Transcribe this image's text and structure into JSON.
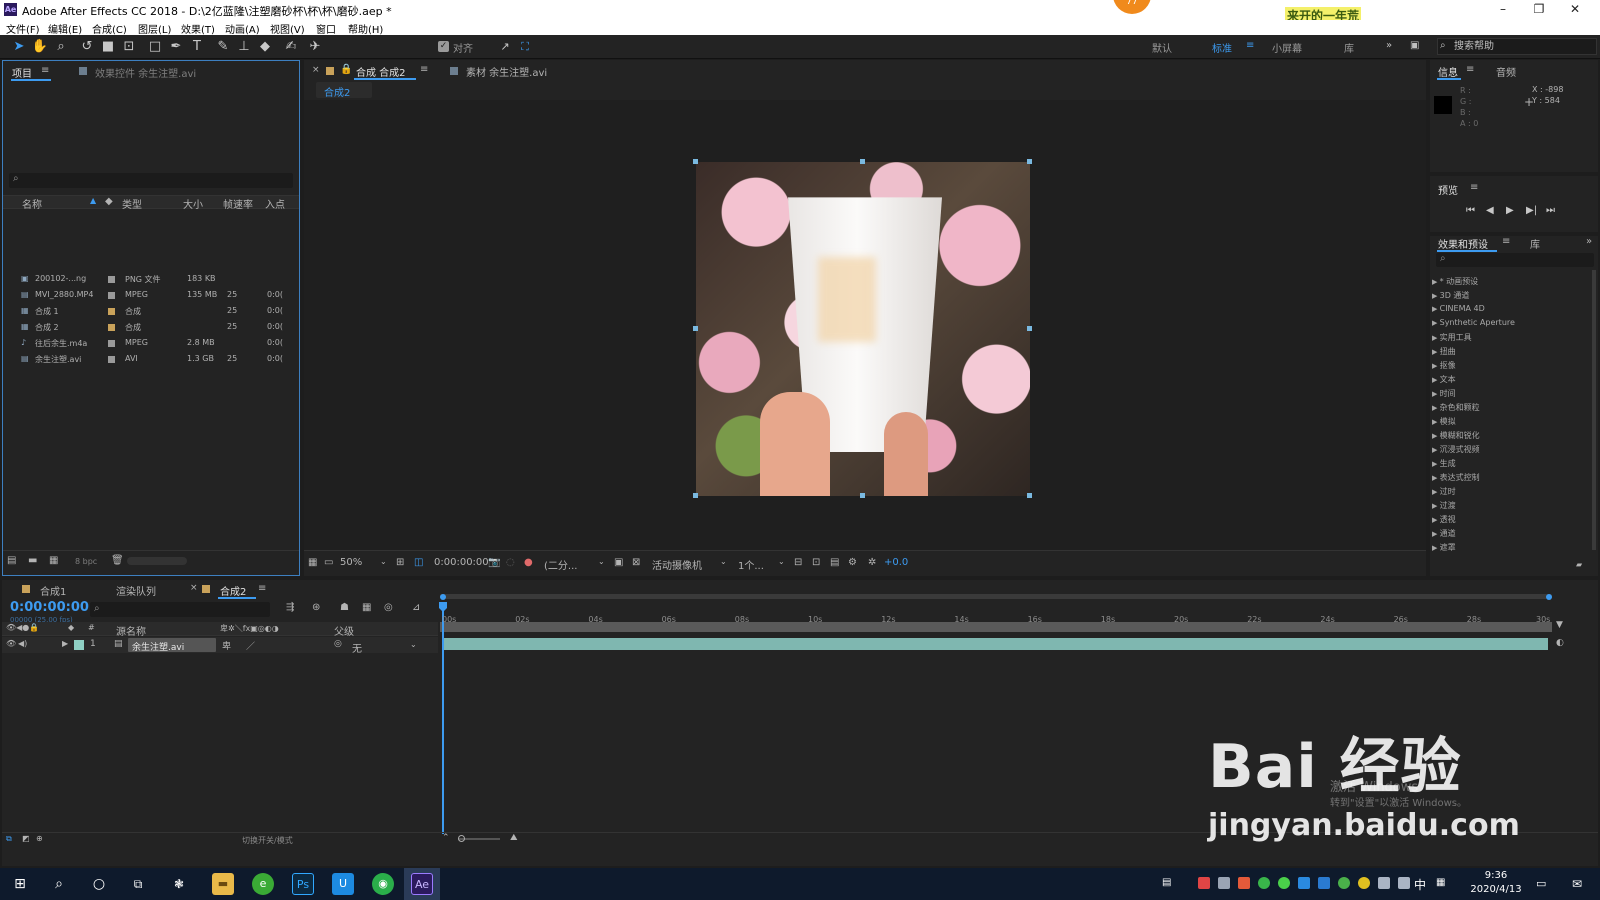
{
  "window": {
    "app_logo": "Ae",
    "title": "Adobe After Effects CC 2018 - D:\\2亿蓝隆\\注塑磨砂杯\\杯\\杯\\磨砂.aep *",
    "banner": "来开的一年荒",
    "badge": "77",
    "controls": [
      "–",
      "❐",
      "✕"
    ]
  },
  "menu": [
    "文件(F)",
    "编辑(E)",
    "合成(C)",
    "图层(L)",
    "效果(T)",
    "动画(A)",
    "视图(V)",
    "窗口",
    "帮助(H)"
  ],
  "toolbar": {
    "align_label": "对齐",
    "workspaces": [
      "默认",
      "标准",
      "小屏幕",
      "库"
    ],
    "active_workspace": "标准",
    "help_placeholder": "搜索帮助"
  },
  "project": {
    "tab": "项目",
    "effect_controls_tab": "效果控件 余生注塑.avi",
    "search_placeholder": "",
    "columns": [
      "名称",
      "类型",
      "大小",
      "帧速率",
      "入点"
    ],
    "rows": [
      {
        "name": "200102-...ng",
        "type": "PNG 文件",
        "size": "183 KB",
        "fps": "",
        "in": "",
        "color": "#9a9a9a"
      },
      {
        "name": "MVI_2880.MP4",
        "type": "MPEG",
        "size": "135 MB",
        "fps": "25",
        "in": "0:0(",
        "color": "#9a9a9a"
      },
      {
        "name": "合成 1",
        "type": "合成",
        "size": "",
        "fps": "25",
        "in": "0:0(",
        "color": "#c9a25a"
      },
      {
        "name": "合成 2",
        "type": "合成",
        "size": "",
        "fps": "25",
        "in": "0:0(",
        "color": "#c9a25a"
      },
      {
        "name": "往后余生.m4a",
        "type": "MPEG",
        "size": "2.8 MB",
        "fps": "",
        "in": "0:0(",
        "color": "#9a9a9a"
      },
      {
        "name": "余生注塑.avi",
        "type": "AVI",
        "size": "1.3 GB",
        "fps": "25",
        "in": "0:0(",
        "color": "#9a9a9a"
      }
    ],
    "bpc": "8 bpc"
  },
  "composition": {
    "tab": "合成 合成2",
    "footage_tab": "素材 余生注塑.avi",
    "breadcrumb": "合成2",
    "zoom": "50%",
    "timecode": "0:00:00:00",
    "resolution": "(二分...",
    "camera": "活动摄像机",
    "views": "1个...",
    "exposure": "+0.0"
  },
  "info": {
    "tab": "信息",
    "audio_tab": "音频",
    "r": "R :",
    "g": "G :",
    "b": "B :",
    "a": "A : 0",
    "x": "X : -898",
    "y": "Y : 584"
  },
  "preview": {
    "tab": "预览"
  },
  "effects": {
    "tab": "效果和预设",
    "library_tab": "库",
    "items": [
      "* 动画预设",
      "3D 通道",
      "CINEMA 4D",
      "Synthetic Aperture",
      "实用工具",
      "扭曲",
      "抠像",
      "文本",
      "时间",
      "杂色和颗粒",
      "模拟",
      "模糊和锐化",
      "沉浸式视频",
      "生成",
      "表达式控制",
      "过时",
      "过渡",
      "透视",
      "通道",
      "遮罩"
    ]
  },
  "timeline": {
    "tabs": [
      "合成1",
      "渲染队列",
      "合成2"
    ],
    "active_tab": "合成2",
    "timecode": "0:00:00:00",
    "frame_info": "00000 (25.00 fps)",
    "col_source": "源名称",
    "col_parent": "父级",
    "layer_num": "1",
    "layer_name": "余生注塑.avi",
    "parent_value": "无",
    "ruler": [
      "00s",
      "02s",
      "04s",
      "06s",
      "08s",
      "10s",
      "12s",
      "14s",
      "16s",
      "18s",
      "20s",
      "22s",
      "24s",
      "26s",
      "28s",
      "30s"
    ],
    "footer": "切换开关/模式"
  },
  "taskbar": {
    "time": "9:36",
    "date": "2020/4/13",
    "ime": "中"
  },
  "watermark": {
    "logo": "Bai 经验",
    "url": "jingyan.baidu.com",
    "activate": "激活 Windows",
    "activate_sub": "转到\"设置\"以激活 Windows。"
  },
  "colors": {
    "accent": "#3d9bf0",
    "layer_bar": "#7fb7b0",
    "ae_purple": "#2b1a5e"
  }
}
